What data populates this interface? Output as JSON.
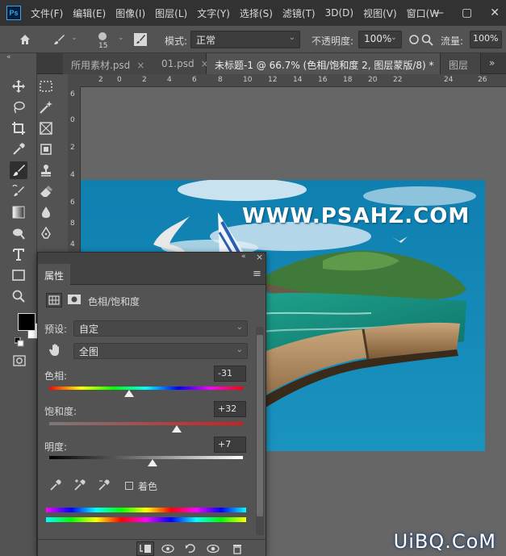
{
  "app": {
    "logo": "Ps",
    "menus": [
      "文件(F)",
      "编辑(E)",
      "图像(I)",
      "图层(L)",
      "文字(Y)",
      "选择(S)",
      "滤镜(T)",
      "3D(D)",
      "视图(V)",
      "窗口(W"
    ],
    "window_controls": {
      "minimize": "—",
      "restore": "▢",
      "close": "✕"
    }
  },
  "options": {
    "brush_size": "15",
    "mode_label": "模式:",
    "mode_value": "正常",
    "opacity_label": "不透明度:",
    "opacity_value": "100%",
    "flow_label": "流量:",
    "flow_value": "100%"
  },
  "tabs": [
    {
      "label": "所用素材.psd",
      "close": "×",
      "active": false
    },
    {
      "label": "01.psd",
      "close": "×",
      "active": false
    },
    {
      "label": "未标题-1 @ 66.7% (色相/饱和度 2, 图层蒙版/8) *",
      "close": "×",
      "active": true
    },
    {
      "label": "图层",
      "close": "",
      "active": false
    }
  ],
  "tabs_overflow": "»",
  "ruler": {
    "h_ticks": [
      "2",
      "0",
      "2",
      "4",
      "6",
      "8",
      "10",
      "12",
      "14",
      "16",
      "18",
      "20",
      "22",
      "24",
      "26"
    ],
    "v_ticks": [
      "6",
      "0",
      "2",
      "4",
      "6",
      "8",
      "4"
    ]
  },
  "canvas": {
    "headline": "WWW.PSAHZ.COM",
    "corner_watermark": "UiBQ.CoM"
  },
  "properties": {
    "tab_label": "属性",
    "adjustment_name": "色相/饱和度",
    "preset_label": "预设:",
    "preset_value": "自定",
    "channel_value": "全图",
    "hue_label": "色相:",
    "hue_value": "-31",
    "hue_level": -31,
    "saturation_label": "饱和度:",
    "saturation_value": "+32",
    "saturation_level": 32,
    "lightness_label": "明度:",
    "lightness_value": "+7",
    "lightness_level": 7,
    "colorize_label": "着色"
  },
  "colors": {
    "menubar": "#323232",
    "panel": "#535353",
    "canvas_bg": "#666666",
    "doc_sky": "#1789b4"
  }
}
